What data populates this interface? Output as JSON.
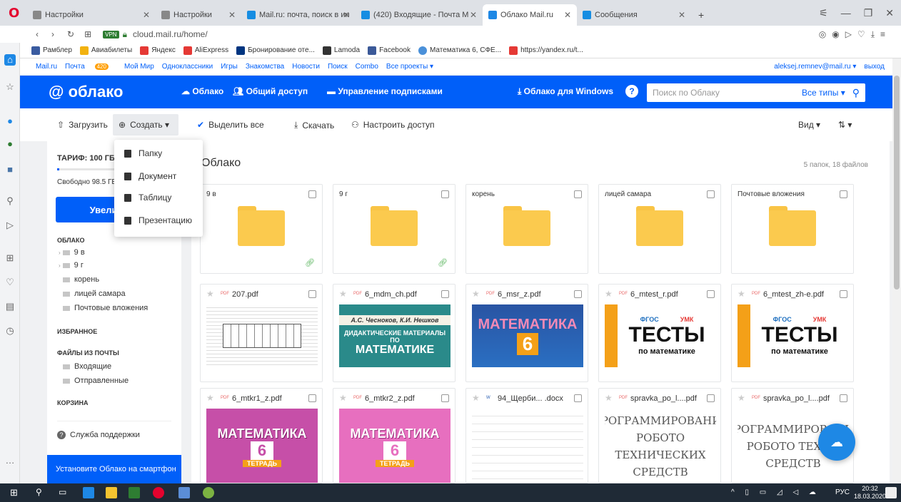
{
  "browser": {
    "tabs": [
      {
        "label": "Настройки",
        "color": "#888888"
      },
      {
        "label": "Настройки",
        "color": "#888888"
      },
      {
        "label": "Mail.ru: почта, поиск в ин",
        "color": "#168de2"
      },
      {
        "label": "(420) Входящие - Почта М",
        "color": "#168de2"
      },
      {
        "label": "Облако Mail.ru",
        "color": "#1e88e5"
      },
      {
        "label": "Сообщения",
        "color": "#168de2"
      }
    ],
    "url": "cloud.mail.ru/home/",
    "vpn": "VPN",
    "bookmarks": [
      "Рамблер",
      "Авиабилеты",
      "Яндекс",
      "AliExpress",
      "Бронирование оте...",
      "Lamoda",
      "Facebook",
      "Математика 6, СФЕ...",
      "https://yandex.ru/t..."
    ]
  },
  "portal": {
    "links": [
      "Mail.ru",
      "Почта",
      "Мой Мир",
      "Одноклассники",
      "Игры",
      "Знакомства",
      "Новости",
      "Поиск",
      "Combo",
      "Все проекты ▾"
    ],
    "mail_badge": "420",
    "user": "aleksej.remnev@mail.ru ▾",
    "logout": "выход"
  },
  "header": {
    "logo": "облако",
    "tabs": [
      "Облако",
      "Общий доступ",
      "Управление подписками"
    ],
    "windows": "Облако для Windows",
    "search_placeholder": "Поиск по Облаку",
    "types": "Все типы ▾"
  },
  "toolbar": {
    "upload": "Загрузить",
    "create": "Создать ▾",
    "select_all": "Выделить все",
    "download": "Скачать",
    "share": "Настроить доступ",
    "view": "Вид ▾"
  },
  "create_menu": [
    "Папку",
    "Документ",
    "Таблицу",
    "Презентацию"
  ],
  "sidebar": {
    "tariff": "ТАРИФ: 100 ГБ.",
    "free": "Свободно 98.5 ГБ",
    "upgrade": "Увеличить",
    "cloud_header": "ОБЛАКО",
    "cloud_items": [
      "9 в",
      "9 г",
      "корень",
      "лицей самара",
      "Почтовые вложения"
    ],
    "fav_header": "ИЗБРАННОЕ",
    "mail_header": "ФАЙЛЫ ИЗ ПОЧТЫ",
    "mail_items": [
      "Входящие",
      "Отправленные"
    ],
    "trash_header": "КОРЗИНА",
    "support": "Служба поддержки",
    "promo": "Установите Облако на смартфон"
  },
  "main": {
    "title": "Облако",
    "count": "5 папок, 18 файлов",
    "folders": [
      {
        "name": "9 в",
        "shared": true
      },
      {
        "name": "9 г",
        "shared": true
      },
      {
        "name": "корень",
        "shared": false
      },
      {
        "name": "лицей самара",
        "shared": false
      },
      {
        "name": "Почтовые вложения",
        "shared": false
      }
    ],
    "files_row1": [
      {
        "name": "207.pdf",
        "type": "PDF",
        "thumb": ""
      },
      {
        "name": "6_mdm_ch.pdf",
        "type": "PDF",
        "thumb": "А.С. Чесноков, К.И. Нешков"
      },
      {
        "name": "6_msr_z.pdf",
        "type": "PDF",
        "thumb": "МАТЕМАТИКА"
      },
      {
        "name": "6_mtest_r.pdf",
        "type": "PDF",
        "thumb": "ТЕСТЫ"
      },
      {
        "name": "6_mtest_zh-e.pdf",
        "type": "PDF",
        "thumb": "ТЕСТЫ"
      }
    ],
    "files_row2": [
      {
        "name": "6_mtkr1_z.pdf",
        "type": "PDF",
        "thumb": "МАТЕМАТИКА"
      },
      {
        "name": "6_mtkr2_z.pdf",
        "type": "PDF",
        "thumb": "МАТЕМАТИКА"
      },
      {
        "name": "94_Щерби... .docx",
        "type": "W",
        "thumb": ""
      },
      {
        "name": "spravka_po_l....pdf",
        "type": "PDF",
        "thumb": "ПРОГРАММИРОВАНИЕ РОБОТО ТЕХНИЧЕСКИХ СРЕДСТВ"
      },
      {
        "name": "spravka_po_l....pdf",
        "type": "PDF",
        "thumb": "ПРОГРАММИРОВАНИЕ РОБОТО ТЕХНИ СРЕДСТВ"
      }
    ]
  },
  "thumb_texts": {
    "didactic": "ДИДАКТИЧЕСКИЕ МАТЕРИАЛЫ ПО",
    "matematike": "МАТЕМАТИКЕ",
    "fgos": "ФГОС",
    "umk": "УМК",
    "po_mat": "по математике",
    "six": "6",
    "tetrad": "ТЕТРАДЬ"
  },
  "taskbar": {
    "lang": "РУС",
    "time": "20:32",
    "date": "18.03.2020"
  }
}
